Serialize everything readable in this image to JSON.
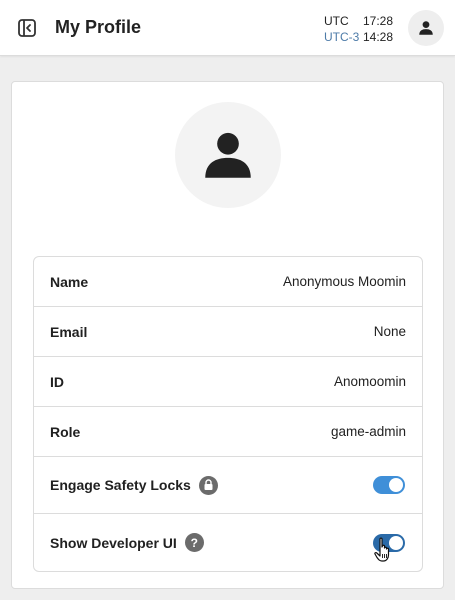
{
  "header": {
    "title": "My Profile",
    "clock": [
      {
        "zone": "UTC",
        "time": "17:28"
      },
      {
        "zone": "UTC-3",
        "time": "14:28"
      }
    ]
  },
  "profile": {
    "rows": [
      {
        "label": "Name",
        "value": "Anonymous Moomin"
      },
      {
        "label": "Email",
        "value": "None"
      },
      {
        "label": "ID",
        "value": "Anomoomin"
      },
      {
        "label": "Role",
        "value": "game-admin"
      }
    ],
    "toggles": [
      {
        "label": "Engage Safety Locks",
        "icon": "lock-icon",
        "on": true
      },
      {
        "label": "Show Developer UI",
        "icon": "help-icon",
        "on": true
      }
    ]
  },
  "colors": {
    "toggle_on": "#3f8fd8",
    "toggle_on_hover": "#2a6aa8",
    "secondary_zone": "#4d7ba8"
  }
}
